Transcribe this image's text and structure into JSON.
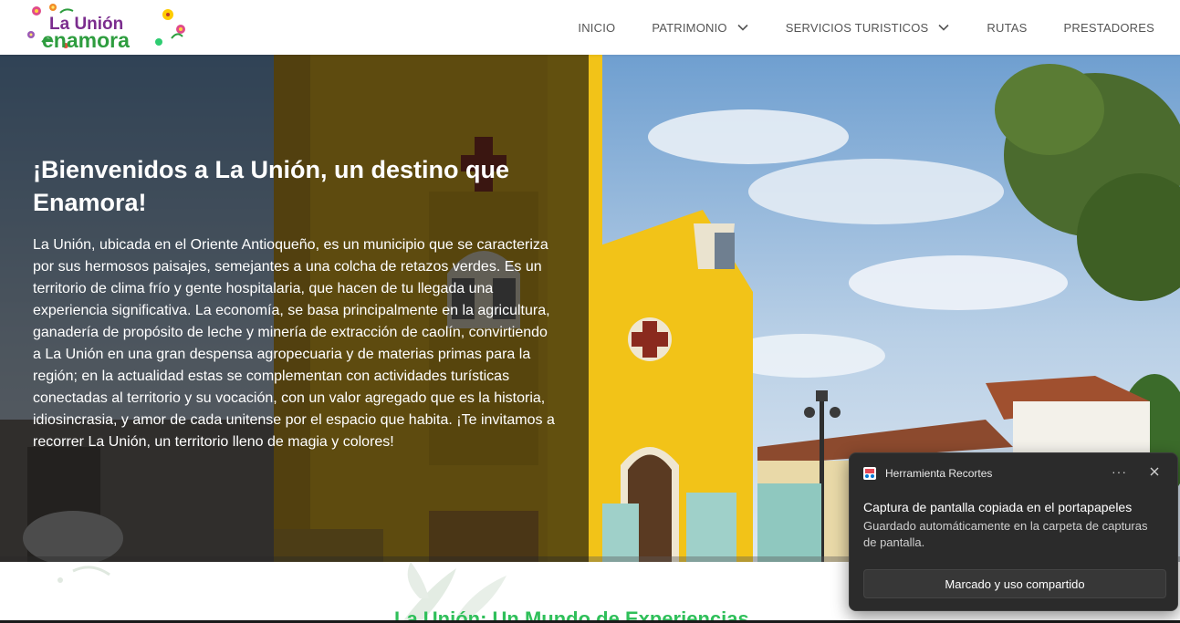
{
  "header": {
    "logo_text_top": "La Unión",
    "logo_text_bottom": "enamora",
    "nav": [
      {
        "label": "INICIO",
        "dropdown": false
      },
      {
        "label": "PATRIMONIO",
        "dropdown": true
      },
      {
        "label": "SERVICIOS TURISTICOS",
        "dropdown": true
      },
      {
        "label": "RUTAS",
        "dropdown": false
      },
      {
        "label": "PRESTADORES",
        "dropdown": false
      }
    ]
  },
  "hero": {
    "title": "¡Bienvenidos a La Unión, un destino que Enamora!",
    "text": "La Unión, ubicada en el Oriente Antioqueño, es un municipio que se caracteriza por sus hermosos paisajes, semejantes a una colcha de retazos verdes. Es un territorio de clima frío y gente hospitalaria, que hacen de tu llegada una experiencia significativa. La economía, se basa principalmente en la agricultura, ganadería de propósito de leche y minería de extracción de caolín, convirtiendo a La Unión en una gran despensa agropecuaria y de materias primas para la región; en la actualidad estas se complementan con actividades turísticas conectadas al territorio y su vocación, con un valor agregado que es la historia, idiosincrasia, y amor de cada unitense por el espacio que habita. ¡Te invitamos a recorrer La Unión, un territorio lleno de magia y colores!"
  },
  "section": {
    "title": "La Unión: Un Mundo de Experiencias"
  },
  "toast": {
    "app_name": "Herramienta Recortes",
    "more_label": "···",
    "title": "Captura de pantalla copiada en el portapapeles",
    "body": "Guardado automáticamente en la carpeta de capturas de pantalla.",
    "button_label": "Marcado y uso compartido"
  },
  "colors": {
    "accent_green": "#2fbf5a",
    "logo_green": "#2e9d3f",
    "logo_purple": "#7b2d8e",
    "church_yellow": "#f2c318",
    "sky_blue": "#8fb6dc",
    "toast_bg": "#2b2b2b"
  }
}
